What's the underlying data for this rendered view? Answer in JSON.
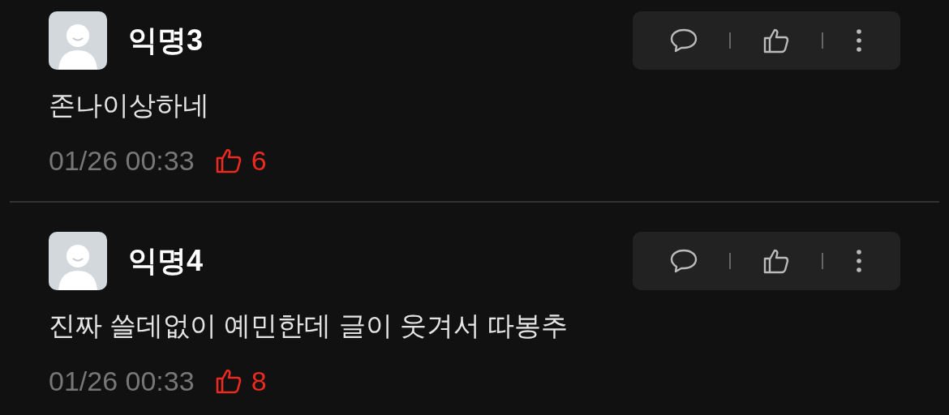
{
  "comments": [
    {
      "name": "익명3",
      "text": "존나이상하네",
      "time": "01/26 00:33",
      "likes": "6"
    },
    {
      "name": "익명4",
      "text": "진짜 쓸데없이 예민한데 글이 웃겨서 따봉추",
      "time": "01/26 00:33",
      "likes": "8"
    }
  ]
}
